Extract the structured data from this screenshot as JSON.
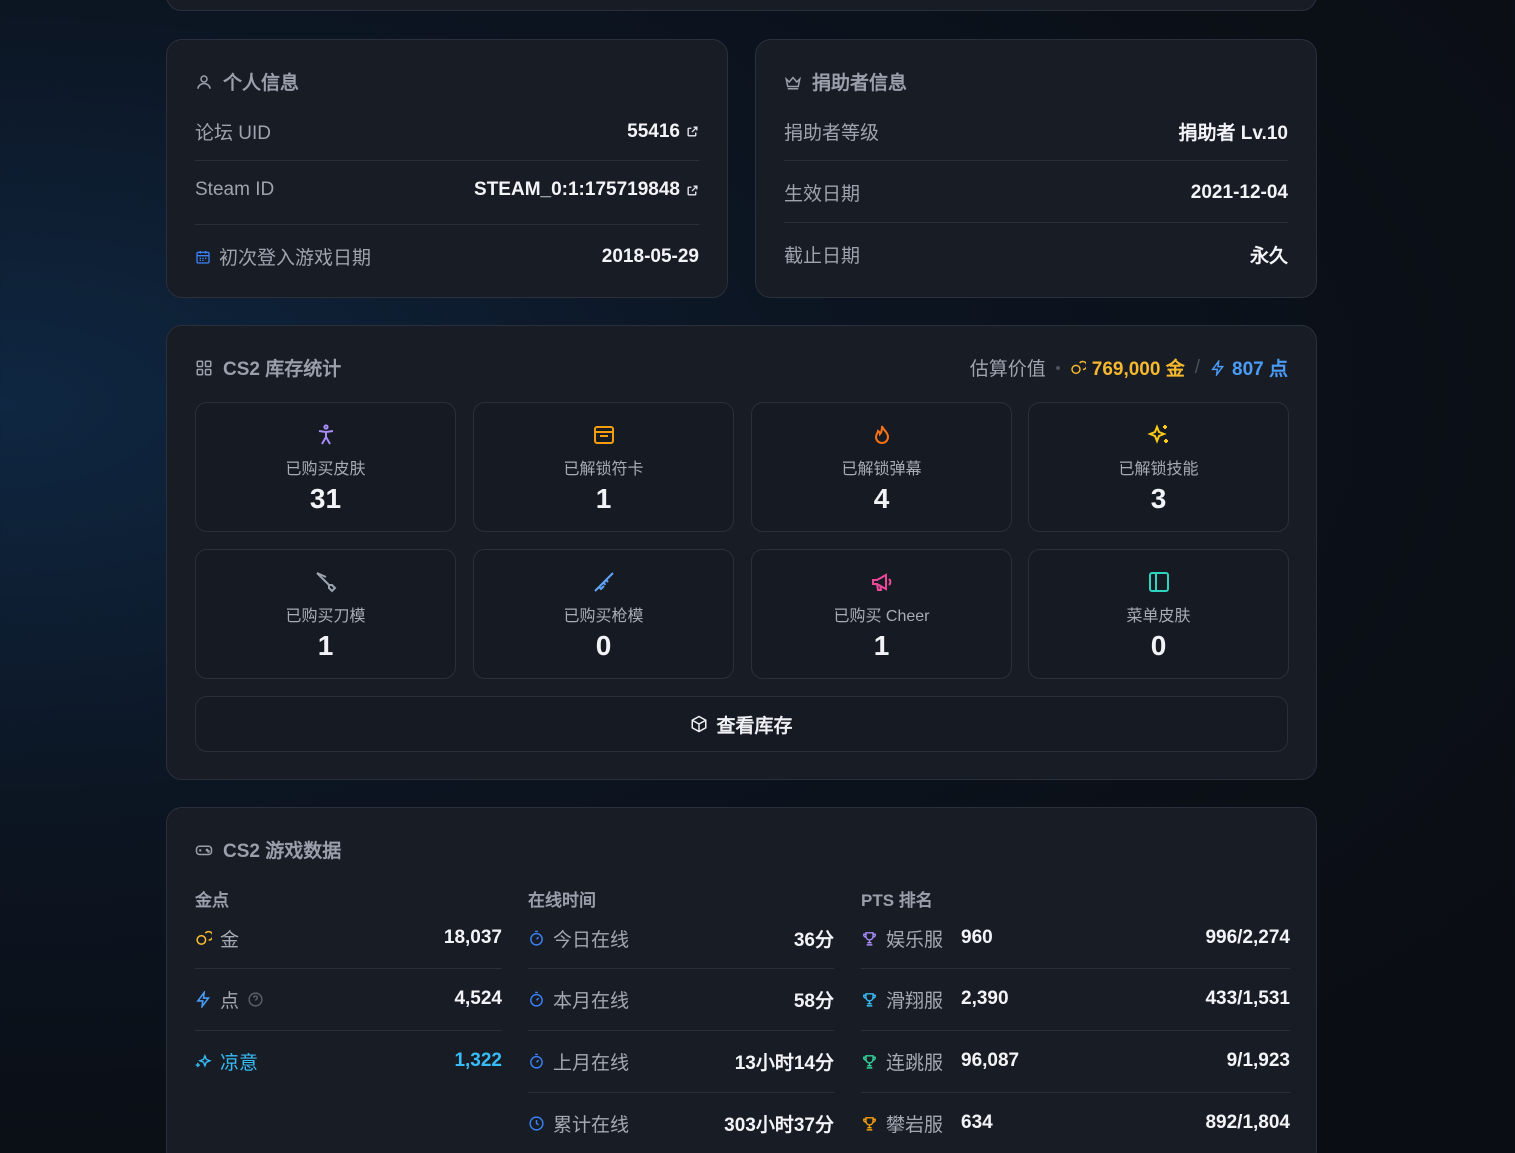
{
  "personal": {
    "title": "个人信息",
    "uid_label": "论坛 UID",
    "uid_value": "55416",
    "steam_label": "Steam ID",
    "steam_value": "STEAM_0:1:175719848",
    "first_login_label": "初次登入游戏日期",
    "first_login_value": "2018-05-29"
  },
  "donor": {
    "title": "捐助者信息",
    "level_label": "捐助者等级",
    "level_value": "捐助者 Lv.10",
    "start_label": "生效日期",
    "start_value": "2021-12-04",
    "end_label": "截止日期",
    "end_value": "永久"
  },
  "inventory": {
    "title": "CS2 库存统计",
    "estimate_label": "估算价值",
    "gold_value": "769,000 金",
    "points_value": "807 点",
    "tiles": [
      {
        "label": "已购买皮肤",
        "value": "31",
        "icon": "person-icon",
        "color": "#a78bfa"
      },
      {
        "label": "已解锁符卡",
        "value": "1",
        "icon": "card-icon",
        "color": "#f59e0b"
      },
      {
        "label": "已解锁弹幕",
        "value": "4",
        "icon": "flame-icon",
        "color": "#f97316"
      },
      {
        "label": "已解锁技能",
        "value": "3",
        "icon": "sparkles-icon",
        "color": "#facc15"
      },
      {
        "label": "已购买刀模",
        "value": "1",
        "icon": "knife-icon",
        "color": "#9ca3af"
      },
      {
        "label": "已购买枪模",
        "value": "0",
        "icon": "rifle-icon",
        "color": "#60a5fa"
      },
      {
        "label": "已购买 Cheer",
        "value": "1",
        "icon": "megaphone-icon",
        "color": "#ec4899"
      },
      {
        "label": "菜单皮肤",
        "value": "0",
        "icon": "panel-icon",
        "color": "#2dd4bf"
      }
    ],
    "view_button": "查看库存"
  },
  "game": {
    "title": "CS2 游戏数据",
    "currency_header": "金点",
    "currency": [
      {
        "label": "金",
        "value": "18,037",
        "icon": "coins-icon",
        "color": "#f5b82e"
      },
      {
        "label": "点",
        "value": "4,524",
        "icon": "bolt-icon",
        "color": "#4a9cf7"
      },
      {
        "label": "凉意",
        "value": "1,322",
        "icon": "snow-sparkle-icon",
        "color": "#38bdf8"
      }
    ],
    "online_header": "在线时间",
    "online": [
      {
        "label": "今日在线",
        "value": "36分"
      },
      {
        "label": "本月在线",
        "value": "58分"
      },
      {
        "label": "上月在线",
        "value": "13小时14分"
      },
      {
        "label": "累计在线",
        "value": "303小时37分"
      }
    ],
    "pts_header": "PTS 排名",
    "pts": [
      {
        "server": "娱乐服",
        "score": "960",
        "rank": "996/2,274",
        "color": "#a78bfa"
      },
      {
        "server": "滑翔服",
        "score": "2,390",
        "rank": "433/1,531",
        "color": "#38bdf8"
      },
      {
        "server": "连跳服",
        "score": "96,087",
        "rank": "9/1,923",
        "color": "#34d399"
      },
      {
        "server": "攀岩服",
        "score": "634",
        "rank": "892/1,804",
        "color": "#f59e0b"
      }
    ]
  }
}
